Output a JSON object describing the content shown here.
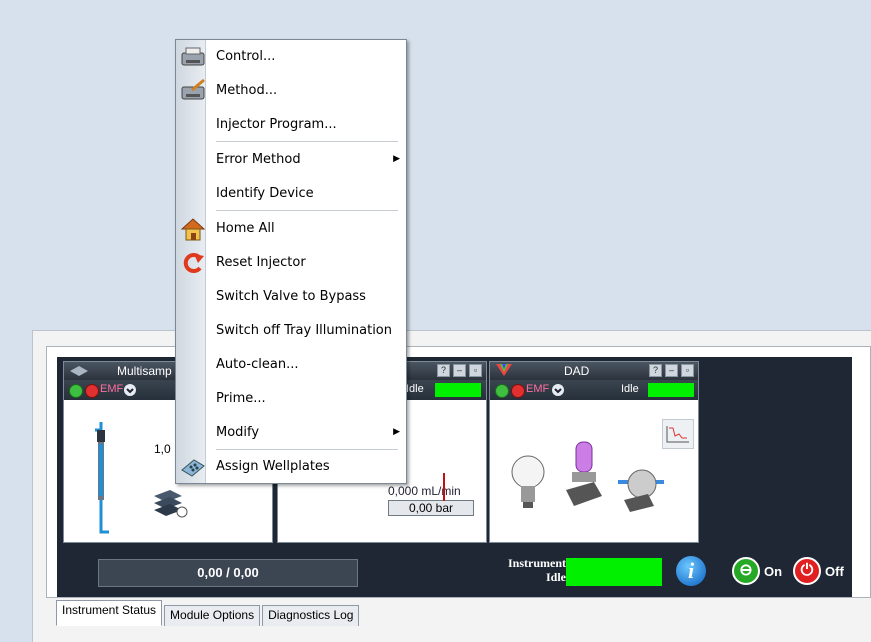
{
  "context_menu": {
    "items": [
      {
        "label": "Control...",
        "icon": "printer-control-icon",
        "submenu": false
      },
      {
        "label": "Method...",
        "icon": "printer-method-icon",
        "submenu": false
      },
      {
        "label": "Injector Program...",
        "icon": "",
        "submenu": false
      },
      {
        "label": "Error Method",
        "icon": "",
        "submenu": true
      },
      {
        "label": "Identify Device",
        "icon": "",
        "submenu": false
      },
      {
        "label": "Home All",
        "icon": "house-icon",
        "submenu": false
      },
      {
        "label": "Reset Injector",
        "icon": "reset-arrow-icon",
        "submenu": false
      },
      {
        "label": "Switch Valve to Bypass",
        "icon": "",
        "submenu": false
      },
      {
        "label": "Switch off Tray Illumination",
        "icon": "",
        "submenu": false
      },
      {
        "label": "Auto-clean...",
        "icon": "",
        "submenu": false
      },
      {
        "label": "Prime...",
        "icon": "",
        "submenu": false
      },
      {
        "label": "Modify",
        "icon": "",
        "submenu": true
      },
      {
        "label": "Assign Wellplates",
        "icon": "wellplate-icon",
        "submenu": false
      }
    ]
  },
  "modules": {
    "sampler": {
      "title": "Multisamp",
      "emf": "EMF",
      "value": "1,0"
    },
    "pump": {
      "title": "",
      "idle": "Idle",
      "flow": "0,000 mL/min",
      "pressure": "0,00 bar"
    },
    "dad": {
      "title": "DAD",
      "emf": "EMF",
      "idle": "Idle"
    }
  },
  "status_bar": {
    "progress": "0,00 / 0,00",
    "instrument_line1": "Instrument",
    "instrument_line2": "Idle",
    "on_label": "On",
    "off_label": "Off",
    "info_glyph": "i"
  },
  "tabs": [
    "Instrument Status",
    "Module Options",
    "Diagnostics Log"
  ],
  "colors": {
    "idle_green": "#00f000",
    "panel_dark": "#1e2733"
  }
}
